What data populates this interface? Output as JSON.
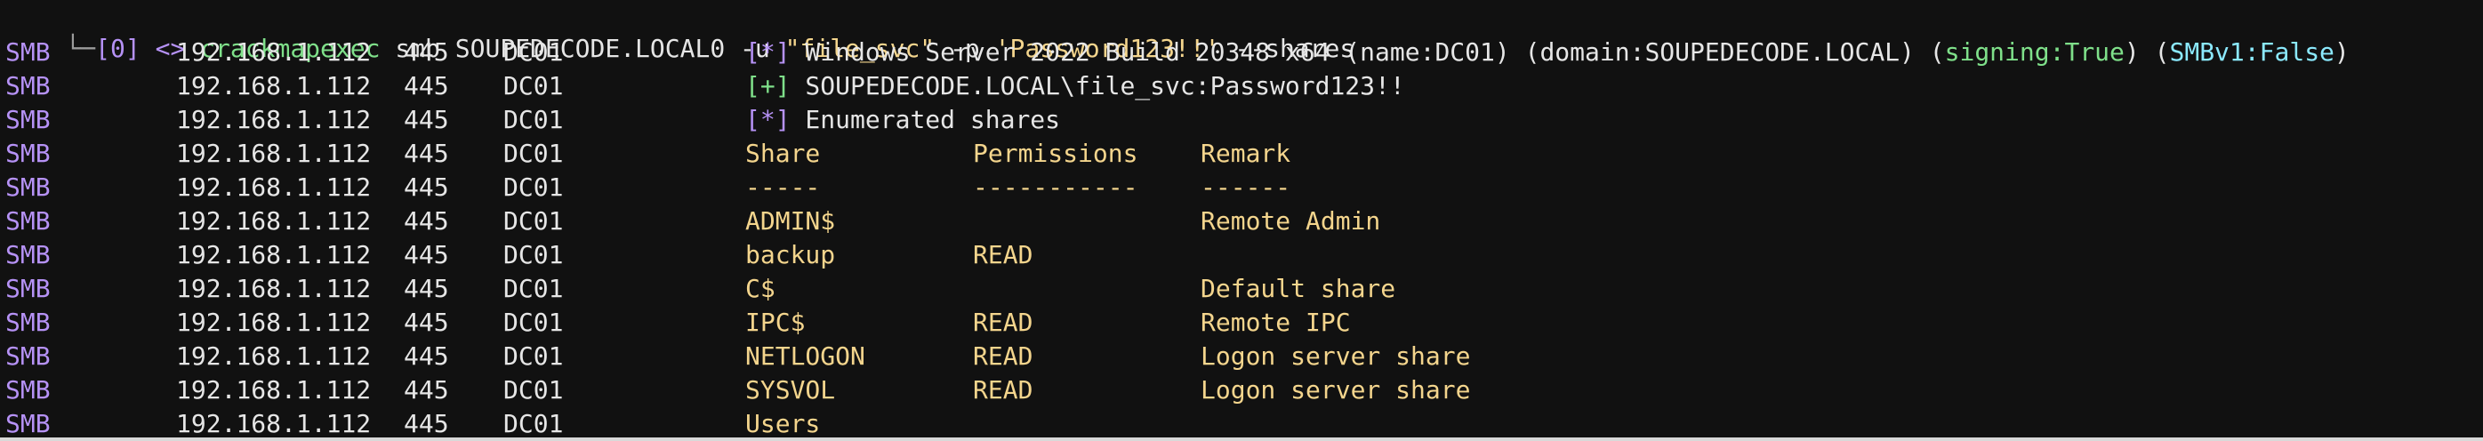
{
  "prompt": {
    "corner": "└─",
    "job": "[0]",
    "arrows": "<>",
    "command": "crackmapexec",
    "args_plain_1": "smb SOUPEDECODE.LOCAL0 -u ",
    "user_arg": "\"file_svc\"",
    "args_plain_2": " -p ",
    "pass_arg": "'Password123!!'",
    "args_plain_3": " --shares"
  },
  "rows": [
    {
      "proto": "SMB",
      "ip": "192.168.1.112",
      "port": "445",
      "host": "DC01"
    },
    {
      "proto": "SMB",
      "ip": "192.168.1.112",
      "port": "445",
      "host": "DC01"
    },
    {
      "proto": "SMB",
      "ip": "192.168.1.112",
      "port": "445",
      "host": "DC01"
    },
    {
      "proto": "SMB",
      "ip": "192.168.1.112",
      "port": "445",
      "host": "DC01"
    },
    {
      "proto": "SMB",
      "ip": "192.168.1.112",
      "port": "445",
      "host": "DC01"
    },
    {
      "proto": "SMB",
      "ip": "192.168.1.112",
      "port": "445",
      "host": "DC01"
    },
    {
      "proto": "SMB",
      "ip": "192.168.1.112",
      "port": "445",
      "host": "DC01"
    },
    {
      "proto": "SMB",
      "ip": "192.168.1.112",
      "port": "445",
      "host": "DC01"
    },
    {
      "proto": "SMB",
      "ip": "192.168.1.112",
      "port": "445",
      "host": "DC01"
    },
    {
      "proto": "SMB",
      "ip": "192.168.1.112",
      "port": "445",
      "host": "DC01"
    },
    {
      "proto": "SMB",
      "ip": "192.168.1.112",
      "port": "445",
      "host": "DC01"
    },
    {
      "proto": "SMB",
      "ip": "192.168.1.112",
      "port": "445",
      "host": "DC01"
    }
  ],
  "messages": {
    "info_marker": "[*]",
    "ok_marker": "[+]",
    "os_info": " Windows Server 2022 Build 20348 x64 (name:DC01) (domain:SOUPEDECODE.LOCAL) (",
    "signing": "signing:True",
    "mid": ") (",
    "smbv1": "SMBv1:False",
    "end": ")",
    "auth_success": " SOUPEDECODE.LOCAL\\file_svc:Password123!!",
    "enumerated": " Enumerated shares"
  },
  "share_table": {
    "headers": {
      "share": "Share",
      "permissions": "Permissions",
      "remark": "Remark"
    },
    "separators": {
      "share": "-----",
      "permissions": "-----------",
      "remark": "------"
    },
    "entries": [
      {
        "share": "ADMIN$",
        "permissions": "",
        "remark": "Remote Admin"
      },
      {
        "share": "backup",
        "permissions": "READ",
        "remark": ""
      },
      {
        "share": "C$",
        "permissions": "",
        "remark": "Default share"
      },
      {
        "share": "IPC$",
        "permissions": "READ",
        "remark": "Remote IPC"
      },
      {
        "share": "NETLOGON",
        "permissions": "READ",
        "remark": "Logon server share"
      },
      {
        "share": "SYSVOL",
        "permissions": "READ",
        "remark": "Logon server share"
      },
      {
        "share": "Users",
        "permissions": "",
        "remark": ""
      }
    ]
  },
  "colors": {
    "background": "#111111",
    "text": "#e6e6e6",
    "purple": "#b692f6",
    "green": "#7fe08a",
    "yellow": "#f4d58d",
    "cyan": "#8be9fd"
  }
}
